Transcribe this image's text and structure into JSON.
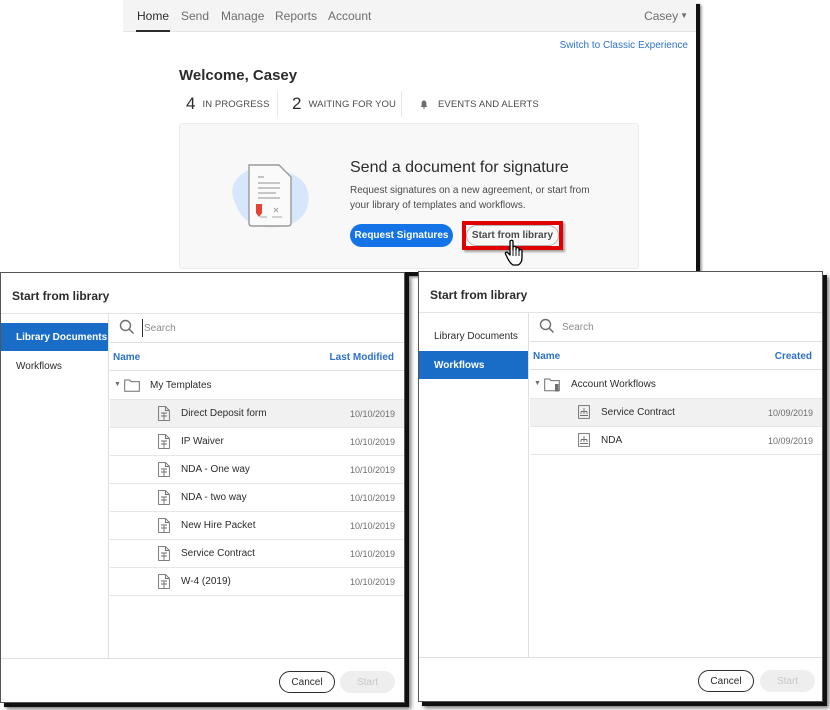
{
  "nav": {
    "tabs": [
      {
        "label": "Home",
        "active": true
      },
      {
        "label": "Send",
        "active": false
      },
      {
        "label": "Manage",
        "active": false
      },
      {
        "label": "Reports",
        "active": false
      },
      {
        "label": "Account",
        "active": false
      }
    ],
    "user": "Casey",
    "classic_link": "Switch to Classic Experience"
  },
  "home": {
    "welcome": "Welcome, Casey",
    "stats": [
      {
        "count": "4",
        "label": "IN PROGRESS"
      },
      {
        "count": "2",
        "label": "WAITING FOR YOU"
      },
      {
        "icon": "bell-icon",
        "label": "EVENTS AND ALERTS"
      }
    ],
    "card": {
      "title": "Send a document for signature",
      "description": "Request signatures on a new agreement, or start from your library of templates and workflows.",
      "primary_button": "Request Signatures",
      "secondary_button": "Start from library"
    },
    "colors": {
      "accent": "#1473e6",
      "highlight": "#e00000"
    }
  },
  "dialog_library": {
    "title": "Start from library",
    "sidebar": [
      {
        "label": "Library Documents",
        "active": true
      },
      {
        "label": "Workflows",
        "active": false
      }
    ],
    "search_placeholder": "Search",
    "columns": {
      "name": "Name",
      "date": "Last Modified"
    },
    "folder": "My Templates",
    "rows": [
      {
        "name": "Direct Deposit form",
        "date": "10/10/2019",
        "selected": true
      },
      {
        "name": "IP Waiver",
        "date": "10/10/2019"
      },
      {
        "name": "NDA - One way",
        "date": "10/10/2019"
      },
      {
        "name": "NDA - two way",
        "date": "10/10/2019"
      },
      {
        "name": "New Hire Packet",
        "date": "10/10/2019"
      },
      {
        "name": "Service Contract",
        "date": "10/10/2019"
      },
      {
        "name": "W-4 (2019)",
        "date": "10/10/2019"
      }
    ],
    "cancel": "Cancel",
    "start": "Start"
  },
  "dialog_workflows": {
    "title": "Start from library",
    "sidebar": [
      {
        "label": "Library Documents",
        "active": false
      },
      {
        "label": "Workflows",
        "active": true
      }
    ],
    "search_placeholder": "Search",
    "columns": {
      "name": "Name",
      "date": "Created"
    },
    "folder": "Account Workflows",
    "rows": [
      {
        "name": "Service Contract",
        "date": "10/09/2019",
        "selected": true
      },
      {
        "name": "NDA",
        "date": "10/09/2019"
      }
    ],
    "cancel": "Cancel",
    "start": "Start"
  }
}
